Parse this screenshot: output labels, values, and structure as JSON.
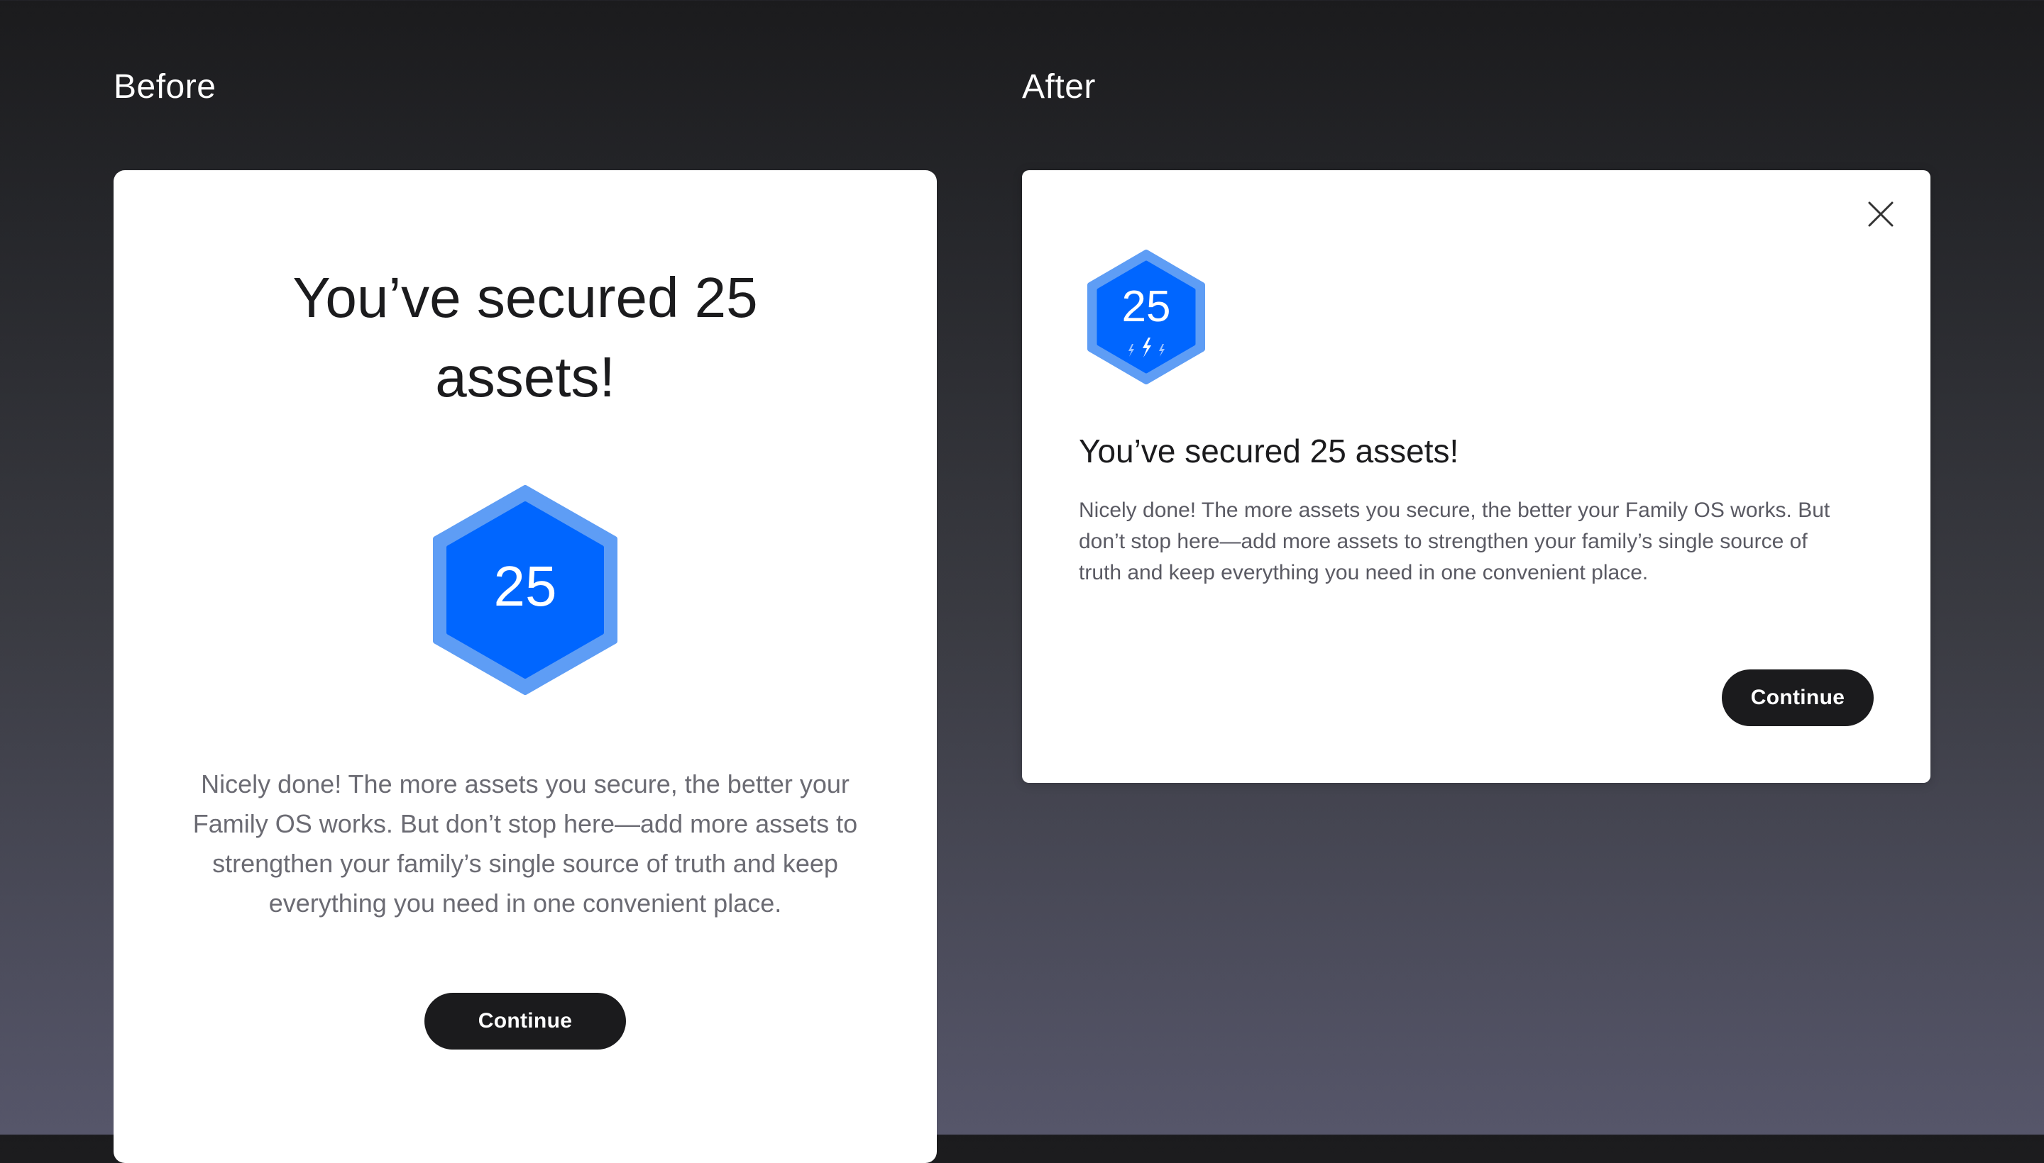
{
  "labels": {
    "before": "Before",
    "after": "After"
  },
  "before_card": {
    "title": "You’ve secured 25 assets!",
    "badge_number": "25",
    "body": "Nicely done! The more assets you secure, the better your Family OS works. But don’t stop here—add more assets to strengthen your family’s single source of truth and keep everything you need in one convenient place.",
    "button_label": "Continue"
  },
  "after_card": {
    "badge_number": "25",
    "title": "You’ve secured 25 assets!",
    "body": "Nicely done! The more assets you secure, the better your Family OS works. But don’t stop here—add more assets to strengthen your family’s single source of truth and keep everything you need in one convenient place.",
    "button_label": "Continue",
    "close_icon": "close-icon",
    "badge_icon": "lightning-bolts-icon"
  },
  "colors": {
    "badge_inner": "#0066ff",
    "badge_outer": "#5e9df5",
    "button_bg": "#1b1b1d",
    "card_bg": "#ffffff"
  }
}
